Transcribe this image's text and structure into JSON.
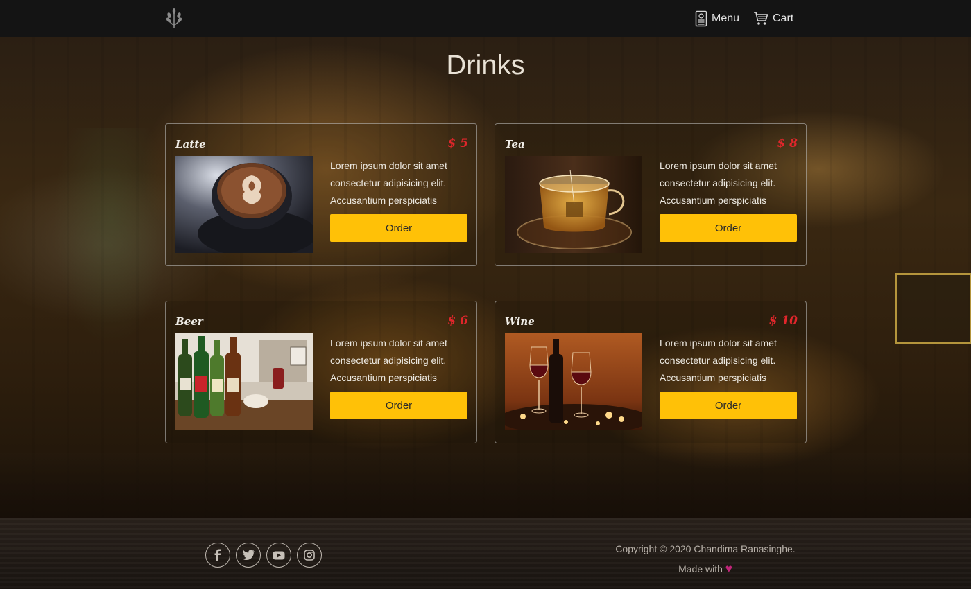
{
  "nav": {
    "logo_icon": "wheat-icon",
    "menu_label": "Menu",
    "menu_icon": "menu-card-icon",
    "cart_label": "Cart",
    "cart_icon": "cart-icon"
  },
  "page": {
    "title": "Drinks"
  },
  "drinks": [
    {
      "name": "Latte",
      "price": "$ 5",
      "image": "latte-art-cup",
      "description": "Lorem ipsum dolor sit amet consectetur adipisicing elit. Accusantium perspiciatis",
      "order_label": "Order"
    },
    {
      "name": "Tea",
      "price": "$ 8",
      "image": "glass-tea-cup",
      "description": "Lorem ipsum dolor sit amet consectetur adipisicing elit. Accusantium perspiciatis",
      "order_label": "Order"
    },
    {
      "name": "Beer",
      "price": "$ 6",
      "image": "beer-bottles",
      "description": "Lorem ipsum dolor sit amet consectetur adipisicing elit. Accusantium perspiciatis",
      "order_label": "Order"
    },
    {
      "name": "Wine",
      "price": "$ 10",
      "image": "wine-glasses-candles",
      "description": "Lorem ipsum dolor sit amet consectetur adipisicing elit. Accusantium perspiciatis",
      "order_label": "Order"
    }
  ],
  "footer": {
    "social": [
      "facebook-icon",
      "twitter-icon",
      "youtube-icon",
      "instagram-icon"
    ],
    "copyright": "Copyright © 2020 Chandima Ranasinghe.",
    "made_with": "Made with",
    "heart_icon": "heart-icon"
  },
  "colors": {
    "accent": "#ffc107",
    "price": "#e0262b",
    "nav_bg": "#141414",
    "heart": "#c2257a"
  }
}
